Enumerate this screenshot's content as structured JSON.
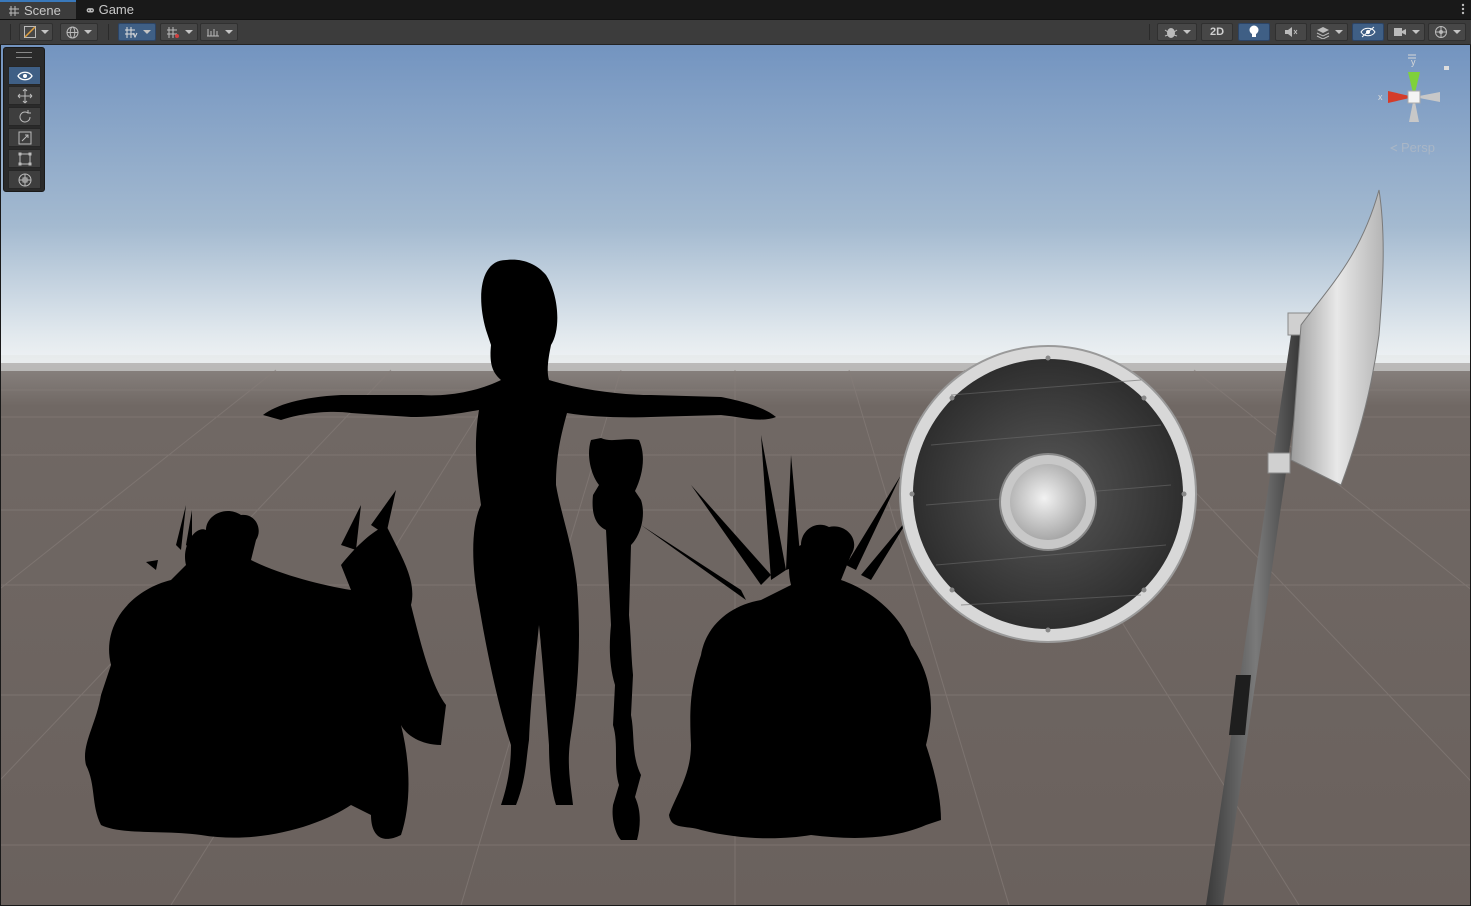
{
  "tabs": [
    {
      "label": "Scene",
      "icon": "grid-icon",
      "active": true
    },
    {
      "label": "Game",
      "icon": "gamepad-icon",
      "active": false
    }
  ],
  "toolbar": {
    "left": [
      "draw-mode-dropdown",
      "global-local-dropdown",
      "grid-snap-dropdown",
      "snap-increment-dropdown",
      "ruler-dropdown"
    ],
    "toggle_2d_label": "2D",
    "right": [
      "gizmo-settings-dropdown",
      "2d-toggle",
      "lighting-toggle",
      "audio-toggle",
      "effects-dropdown",
      "hidden-objects-toggle",
      "camera-dropdown",
      "gizmos-dropdown"
    ]
  },
  "tools": [
    "view-tool",
    "move-tool",
    "rotate-tool",
    "scale-tool",
    "rect-tool",
    "transform-tool"
  ],
  "gizmo": {
    "x_label": "x",
    "y_label": "y",
    "projection": "Persp"
  },
  "colors": {
    "accent": "#3f5f85",
    "tab_accent": "#3a79bb",
    "axis_x": "#d43c2a",
    "axis_y": "#7fd13b",
    "sky_top": "#7d9cc4",
    "ground": "#6c6460"
  }
}
